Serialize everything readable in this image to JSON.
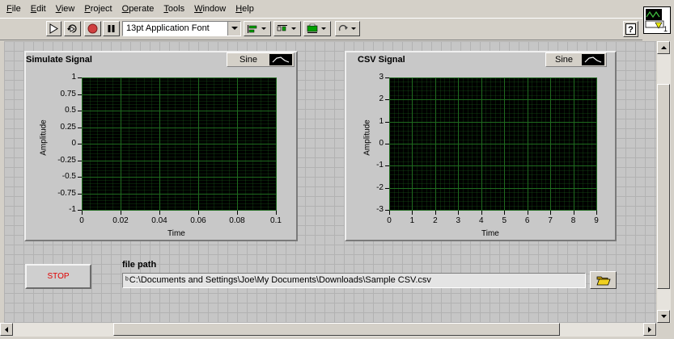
{
  "menu": [
    "File",
    "Edit",
    "View",
    "Project",
    "Operate",
    "Tools",
    "Window",
    "Help"
  ],
  "menu_mnemonic": [
    "F",
    "E",
    "V",
    "P",
    "O",
    "T",
    "W",
    "H"
  ],
  "toolbar": {
    "font_setting": "13pt Application Font",
    "icons": [
      "run-arrow-icon",
      "run-continuously-icon",
      "abort-icon",
      "pause-icon",
      "align-objects-icon",
      "distribute-objects-icon",
      "resize-objects-icon",
      "reorder-icon",
      "context-help-icon"
    ]
  },
  "vi_icon_number": "1",
  "graphs": [
    {
      "title": "Simulate Signal",
      "legend_name": "Sine",
      "y_axis_label": "Amplitude",
      "x_axis_label": "Time",
      "y_ticks": [
        "1",
        "0.75",
        "0.5",
        "0.25",
        "0",
        "-0.25",
        "-0.5",
        "-0.75",
        "-1"
      ],
      "x_ticks": [
        "0",
        "0.02",
        "0.04",
        "0.06",
        "0.08",
        "0.1"
      ]
    },
    {
      "title": "CSV Signal",
      "legend_name": "Sine",
      "y_axis_label": "Amplitude",
      "x_axis_label": "Time",
      "y_ticks": [
        "3",
        "2",
        "1",
        "0",
        "-1",
        "-2",
        "-3"
      ],
      "x_ticks": [
        "0",
        "1",
        "2",
        "3",
        "4",
        "5",
        "6",
        "7",
        "8",
        "9"
      ]
    }
  ],
  "stop_button": {
    "label": "STOP"
  },
  "file_path": {
    "label": "file path",
    "prefix": "ᵇ",
    "value": "C:\\Documents and Settings\\Joe\\My Documents\\Downloads\\Sample CSV.csv"
  },
  "colors": {
    "plot_background": "#000000",
    "grid_line": "#1f6b1f",
    "stop_text": "#e00000",
    "panel_grid": "#b2b2b2"
  }
}
